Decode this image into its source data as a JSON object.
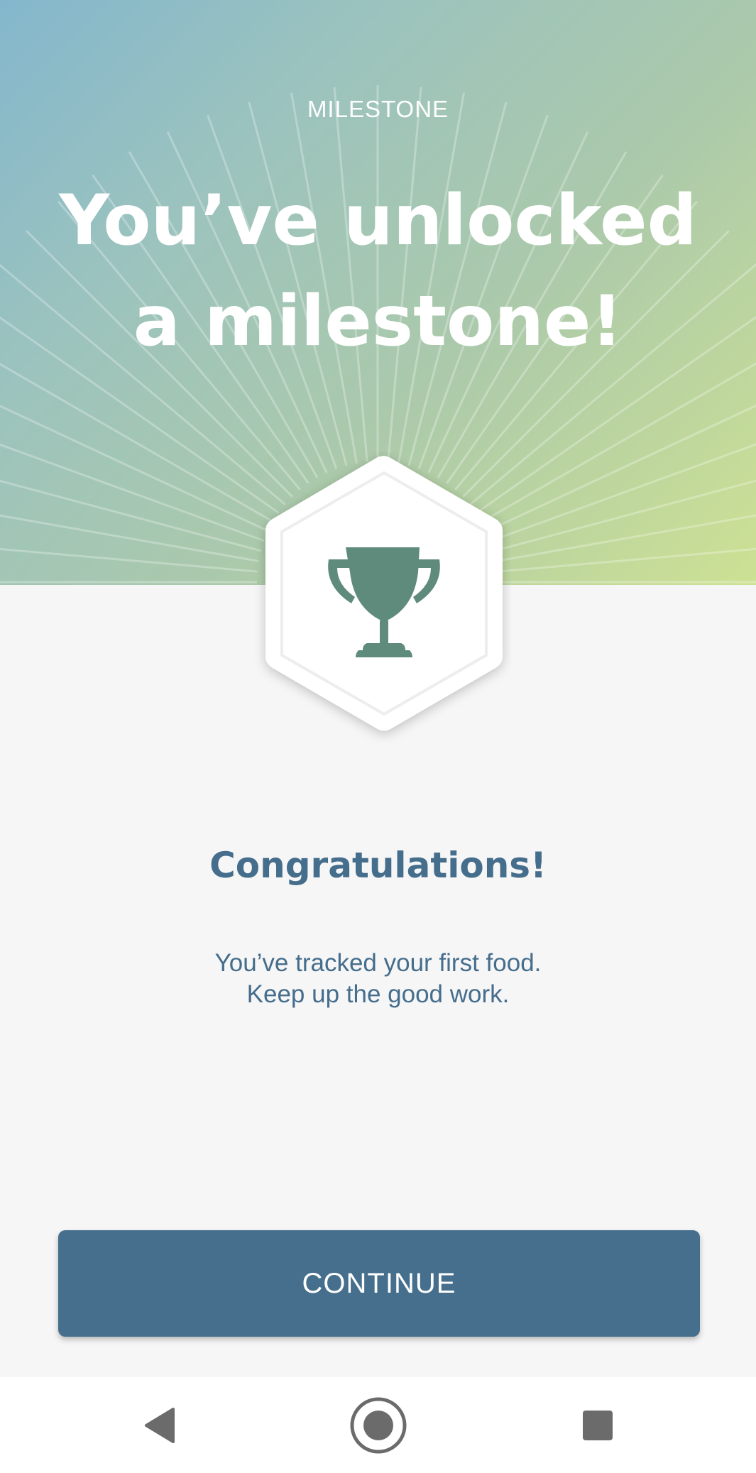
{
  "hero": {
    "eyebrow": "MILESTONE",
    "headline": "You’ve unlocked a milestone!"
  },
  "badge": {
    "icon": "trophy-icon",
    "colors": {
      "trophy": "#5f8b7c",
      "hexagon": "#ffffff"
    }
  },
  "content": {
    "title": "Congratulations!",
    "message_line1": "You’ve tracked your first food.",
    "message_line2": "Keep up the good work."
  },
  "actions": {
    "continue_label": "CONTINUE"
  },
  "navbar": {
    "icons": [
      "back-icon",
      "home-icon",
      "recents-icon"
    ]
  },
  "colors": {
    "accent": "#456f8d",
    "text": "#456d8c",
    "background": "#f6f6f7",
    "gradient": [
      "#84b7cd",
      "#abc9ab",
      "#cde193"
    ]
  }
}
